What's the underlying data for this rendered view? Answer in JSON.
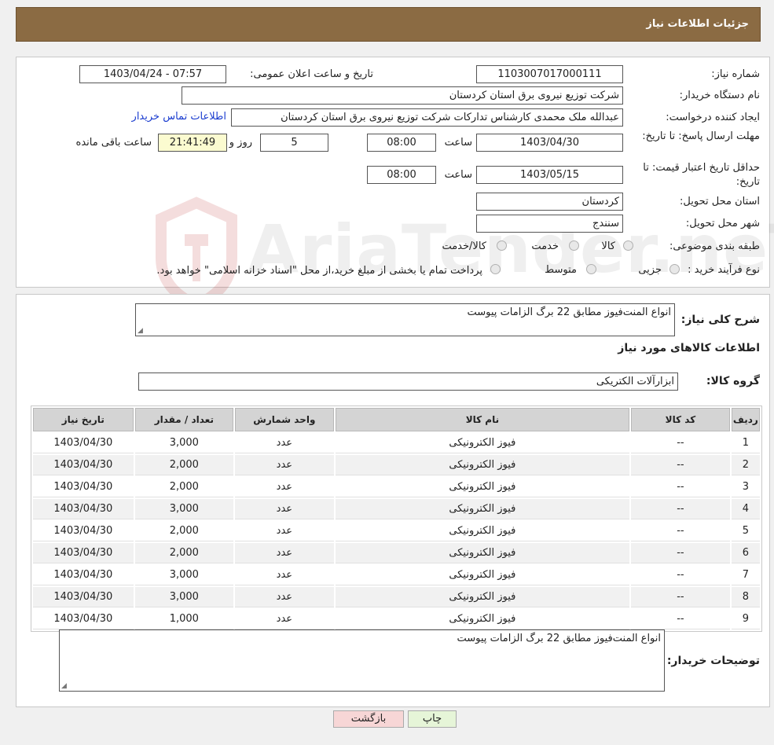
{
  "header": {
    "title": "جزئیات اطلاعات نیاز"
  },
  "form": {
    "need_number_label": "شماره نیاز:",
    "need_number": "1103007017000111",
    "announce_label": "تاریخ و ساعت اعلان عمومی:",
    "announce_value": "1403/04/24 - 07:57",
    "buyer_org_label": "نام دستگاه خریدار:",
    "buyer_org": "شرکت توزیع نیروی برق استان کردستان",
    "creator_label": "ایجاد کننده درخواست:",
    "creator": "عبدالله ملک محمدی کارشناس تدارکات شرکت توزیع نیروی برق استان کردستان",
    "contact_link": "اطلاعات تماس خریدار",
    "reply_deadline_label": "مهلت ارسال پاسخ: تا تاریخ:",
    "reply_date": "1403/04/30",
    "time_label": "ساعت",
    "reply_time": "08:00",
    "days_value": "5",
    "days_label": "روز و",
    "remaining_time": "21:41:49",
    "remaining_label": "ساعت باقی مانده",
    "price_validity_label": "حداقل تاریخ اعتبار قیمت: تا تاریخ:",
    "validity_date": "1403/05/15",
    "validity_time": "08:00",
    "province_label": "استان محل تحویل:",
    "province": "کردستان",
    "city_label": "شهر محل تحویل:",
    "city": "سنندج",
    "category_label": "طبقه بندی موضوعی:",
    "category_options": [
      "کالا",
      "خدمت",
      "کالا/خدمت"
    ],
    "purchase_type_label": "نوع فرآیند خرید :",
    "purchase_options": [
      "جزیی",
      "متوسط"
    ],
    "purchase_note": "پرداخت تمام یا بخشی از مبلغ خرید،از محل \"اسناد خزانه اسلامی\" خواهد بود."
  },
  "details": {
    "summary_label": "شرح کلی نیاز:",
    "summary": "انواع المنت‌فیوز  مطابق 22 برگ الزامات پیوست",
    "goods_info_title": "اطلاعات کالاهای مورد نیاز",
    "group_label": "گروه کالا:",
    "group_value": "ابزارآلات الکتریکی"
  },
  "table": {
    "headers": [
      "ردیف",
      "کد کالا",
      "نام کالا",
      "واحد شمارش",
      "تعداد / مقدار",
      "تاریخ نیاز"
    ],
    "rows": [
      [
        "1",
        "--",
        "فیوز الکترونیکی",
        "عدد",
        "3,000",
        "1403/04/30"
      ],
      [
        "2",
        "--",
        "فیوز الکترونیکی",
        "عدد",
        "2,000",
        "1403/04/30"
      ],
      [
        "3",
        "--",
        "فیوز الکترونیکی",
        "عدد",
        "2,000",
        "1403/04/30"
      ],
      [
        "4",
        "--",
        "فیوز الکترونیکی",
        "عدد",
        "3,000",
        "1403/04/30"
      ],
      [
        "5",
        "--",
        "فیوز الکترونیکی",
        "عدد",
        "2,000",
        "1403/04/30"
      ],
      [
        "6",
        "--",
        "فیوز الکترونیکی",
        "عدد",
        "2,000",
        "1403/04/30"
      ],
      [
        "7",
        "--",
        "فیوز الکترونیکی",
        "عدد",
        "3,000",
        "1403/04/30"
      ],
      [
        "8",
        "--",
        "فیوز الکترونیکی",
        "عدد",
        "3,000",
        "1403/04/30"
      ],
      [
        "9",
        "--",
        "فیوز الکترونیکی",
        "عدد",
        "1,000",
        "1403/04/30"
      ]
    ]
  },
  "buyer_notes": {
    "label": "توضیحات خریدار:",
    "text": "انواع المنت‌فیوز  مطابق 22 برگ الزامات پیوست"
  },
  "buttons": {
    "print": "چاپ",
    "back": "بازگشت"
  },
  "watermark": {
    "text": "AriaTender.neT"
  },
  "colors": {
    "header": "#8b6b43",
    "print_btn": "#e6f5d8",
    "back_btn": "#f7d6d6",
    "link": "#1a3ccf"
  }
}
